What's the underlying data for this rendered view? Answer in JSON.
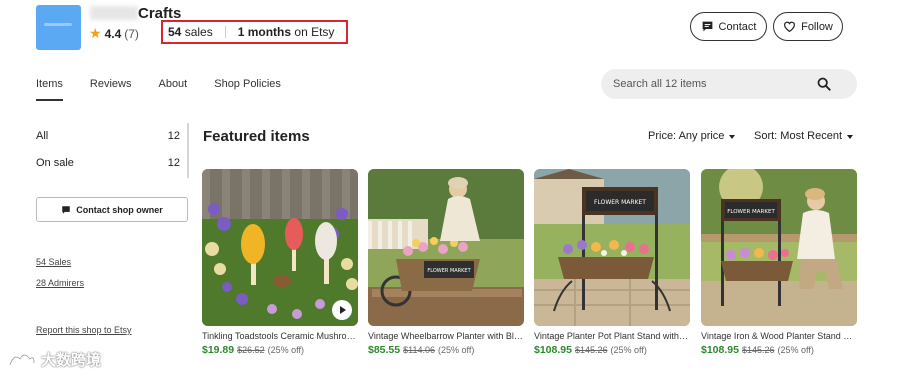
{
  "shop": {
    "name": "Crafts",
    "rating": "4.4",
    "review_count": "(7)",
    "sales_count": "54",
    "sales_label": "sales",
    "age": "1 months",
    "age_suffix": "on Etsy"
  },
  "actions": {
    "contact_label": "Contact",
    "follow_label": "Follow"
  },
  "nav": {
    "tabs": [
      {
        "label": "Items",
        "active": true
      },
      {
        "label": "Reviews",
        "active": false
      },
      {
        "label": "About",
        "active": false
      },
      {
        "label": "Shop Policies",
        "active": false
      }
    ]
  },
  "search": {
    "placeholder": "Search all 12 items"
  },
  "sidebar": {
    "sections": [
      {
        "label": "All",
        "count": "12"
      },
      {
        "label": "On sale",
        "count": "12"
      }
    ],
    "contact_owner_label": "Contact shop owner",
    "sales_link": "54 Sales",
    "admirers_link": "28 Admirers",
    "report_link": "Report this shop to Etsy"
  },
  "main": {
    "featured_title": "Featured items",
    "price_filter": "Price: Any price",
    "sort_filter": "Sort: Most Recent",
    "items": [
      {
        "title": "Tinkling Toadstools Ceramic Mushroom Garden Stakes",
        "price": "$19.89",
        "was": "$26.52",
        "discount": "(25% off)"
      },
      {
        "title": "Vintage Wheelbarrow Planter with Black Flower Market Sign",
        "price": "$85.55",
        "was": "$114.06",
        "discount": "(25% off)"
      },
      {
        "title": "Vintage Planter Pot Plant Stand with Flower Market Sign",
        "price": "$108.95",
        "was": "$145.26",
        "discount": "(25% off)"
      },
      {
        "title": "Vintage Iron & Wood Planter Stand with Flower Market Sign",
        "price": "$108.95",
        "was": "$145.26",
        "discount": "(25% off)"
      }
    ],
    "sign_text": "FLOWER MARKET"
  },
  "watermark": "大数跨境",
  "colors": {
    "accent_green": "#2c8a2c",
    "highlight_red": "#d9262c",
    "logo_blue": "#5aa9f2",
    "star": "#f1a10e"
  }
}
